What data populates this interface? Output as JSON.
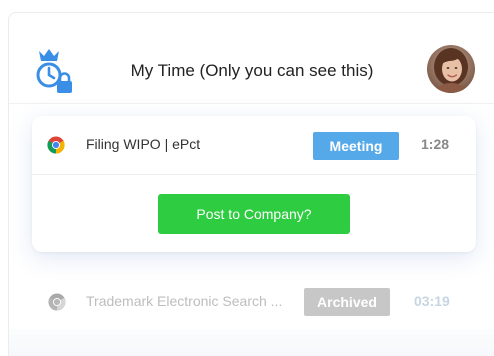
{
  "header": {
    "title": "My Time (Only you can see this)"
  },
  "active_entry": {
    "title": "Filing WIPO | ePct",
    "tag": "Meeting",
    "duration": "1:28",
    "action_label": "Post to Company?"
  },
  "archived_entry": {
    "title": "Trademark Electronic Search ...",
    "tag": "Archived",
    "duration": "03:19"
  },
  "colors": {
    "meeting_badge": "#56a9e8",
    "archived_badge": "#9b9b9b",
    "post_button": "#2ecc40",
    "logo": "#3a8ee6"
  },
  "icons": [
    "crown-clock-lock-icon",
    "chrome-icon",
    "avatar"
  ]
}
